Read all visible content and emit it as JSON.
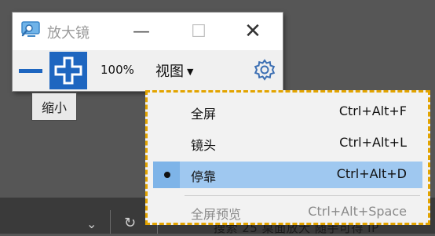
{
  "background": {
    "status_text": "搜索 25 桌面放大 随手可得 IP"
  },
  "window": {
    "title": "放大镜",
    "minimize_glyph": "—",
    "maximize_glyph": "☐",
    "close_glyph": "✕"
  },
  "toolbar": {
    "zoom_level": "100%",
    "view_label": "视图",
    "view_caret": "▼"
  },
  "tooltip": {
    "text": "缩小"
  },
  "menu": {
    "items": [
      {
        "label": "全屏",
        "shortcut": "Ctrl+Alt+F",
        "selected": false,
        "enabled": true
      },
      {
        "label": "镜头",
        "shortcut": "Ctrl+Alt+L",
        "selected": false,
        "enabled": true
      },
      {
        "label": "停靠",
        "shortcut": "Ctrl+Alt+D",
        "selected": true,
        "enabled": true
      },
      {
        "label": "全屏预览",
        "shortcut": "Ctrl+Alt+Space",
        "selected": false,
        "enabled": false
      }
    ]
  },
  "colors": {
    "accent": "#1e66c0",
    "menu_highlight_border": "#e3a400",
    "selected_item": "#9fc8f0"
  },
  "icons": {
    "app": "magnifier-monitor-icon",
    "zoom_out": "minus-icon",
    "zoom_in": "plus-icon",
    "settings": "gear-icon",
    "background_chevron": "chevron-down-icon",
    "background_refresh": "refresh-icon"
  }
}
